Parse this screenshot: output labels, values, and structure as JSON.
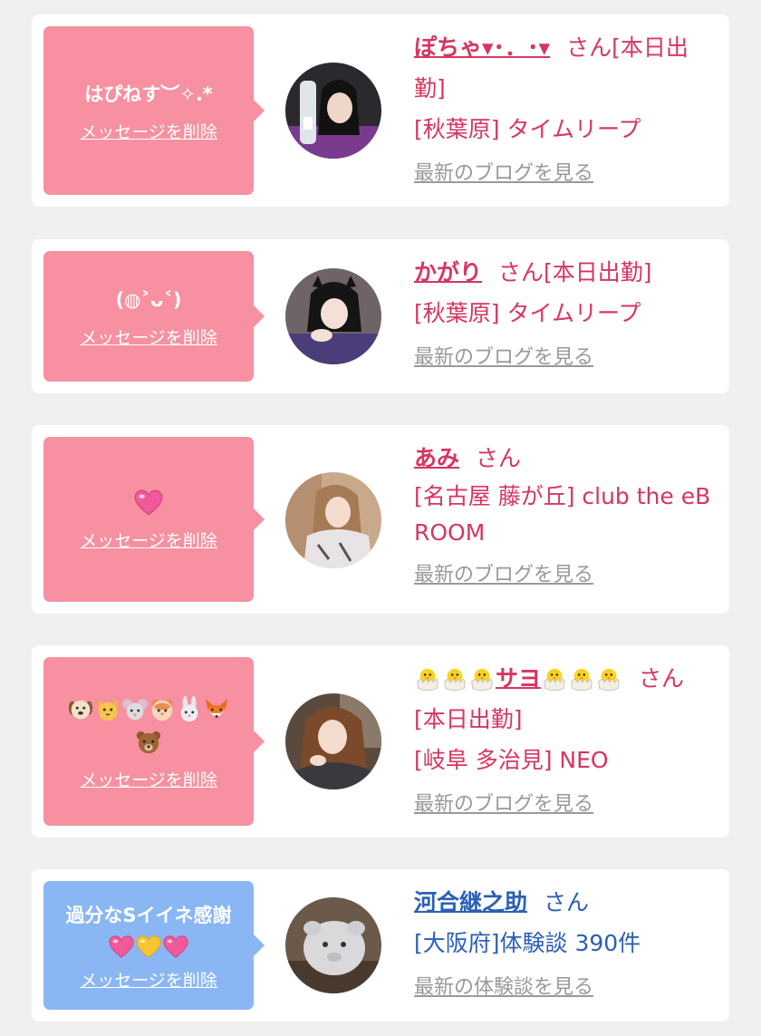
{
  "theme": {
    "pink_bubble": "#f790a0",
    "blue_bubble": "#8ab6f4",
    "pink_text": "#d6365f",
    "blue_text": "#2b5fb8",
    "link_gray": "#999999"
  },
  "delete_label": "メッセージを削除",
  "san_label": "さん",
  "cards": [
    {
      "message": "はぴねす︶✧.*",
      "name": "ぽちゃ▾･．･▾",
      "status": "[本日出勤]",
      "shop": "[秋葉原] タイムリープ",
      "blog_link": "最新のブログを見る"
    },
    {
      "message": "(◍˃ᴗ˂)",
      "name": "かがり",
      "status": "[本日出勤]",
      "shop": "[秋葉原] タイムリープ",
      "blog_link": "最新のブログを見る"
    },
    {
      "message": "💗",
      "name": "あみ",
      "status": "",
      "shop": "[名古屋 藤が丘] club the eBROOM",
      "blog_link": "最新のブログを見る"
    },
    {
      "message_emojis": [
        "dog-face",
        "cat-face",
        "mouse-face",
        "hamster-face",
        "rabbit-face",
        "fox-face",
        "bear-face"
      ],
      "name": "サヨ",
      "name_emojis": [
        "hatching-chick",
        "hatching-chick",
        "hatching-chick",
        "hatching-chick",
        "hatching-chick",
        "hatching-chick"
      ],
      "status": "[本日出勤]",
      "shop": "[岐阜 多治見] NEO",
      "blog_link": "最新のブログを見る"
    },
    {
      "message_text": "過分なSイイネ感謝",
      "message_emojis": [
        "pink-heart",
        "yellow-heart",
        "pink-heart"
      ],
      "name": "河合継之助",
      "shop": "[大阪府]体験談 390件",
      "review_link": "最新の体験談を見る"
    }
  ]
}
